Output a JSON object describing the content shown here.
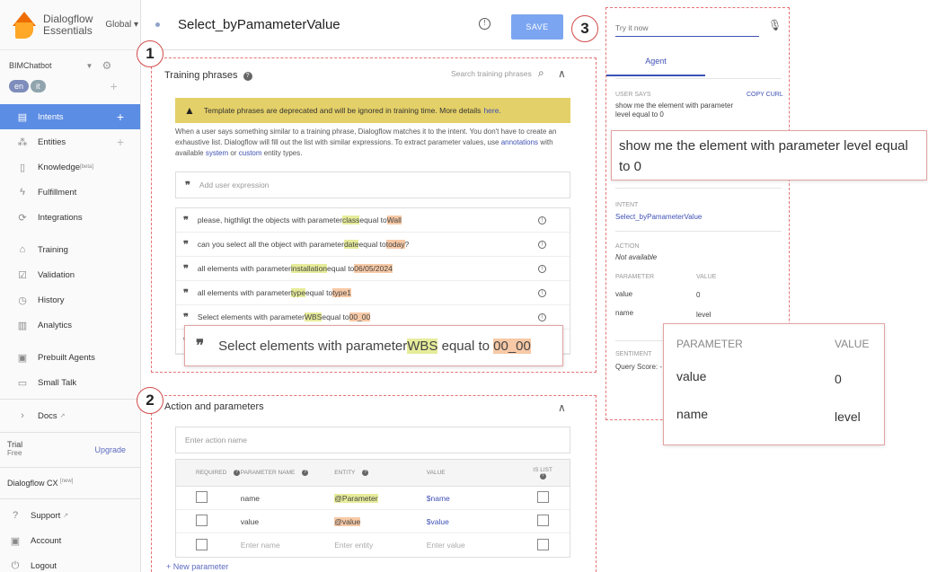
{
  "brand": {
    "name_line1": "Dialogflow",
    "name_line2": "Essentials",
    "region": "Global"
  },
  "agent": {
    "name": "BIMChatbot",
    "langs": [
      "en",
      "it"
    ]
  },
  "nav": {
    "intents": "Intents",
    "entities": "Entities",
    "knowledge": "Knowledge",
    "knowledge_tag": "[beta]",
    "fulfillment": "Fulfillment",
    "integrations": "Integrations",
    "training": "Training",
    "validation": "Validation",
    "history": "History",
    "analytics": "Analytics",
    "prebuilt": "Prebuilt Agents",
    "smalltalk": "Small Talk",
    "docs": "Docs",
    "support": "Support",
    "account": "Account",
    "logout": "Logout"
  },
  "trial": {
    "label": "Trial",
    "plan": "Free",
    "upgrade": "Upgrade"
  },
  "cx": {
    "label": "Dialogflow CX",
    "tag": "[new]"
  },
  "intent": {
    "title": "Select_byPamameterValue",
    "save": "SAVE"
  },
  "badges": [
    "1",
    "2",
    "3"
  ],
  "training": {
    "title": "Training phrases",
    "help": "?",
    "search_placeholder": "Search training phrases",
    "warning": "Template phrases are deprecated and will be ignored in training time. More details",
    "warning_link": "here.",
    "desc_1": "When a user says something similar to a training phrase, Dialogflow matches it to the intent. You don't have to create an exhaustive list. Dialogflow will fill out the list with similar expressions. To extract parameter values, use",
    "desc_annotations": "annotations",
    "desc_2": "with available",
    "desc_system": "system",
    "desc_or": "or",
    "desc_custom": "custom",
    "desc_3": "entity types.",
    "add_placeholder": "Add user expression",
    "phrases": [
      {
        "a": "please, higthligt the objects with parameter ",
        "p": "class",
        "b": " equal to ",
        "v": "Wall",
        "c": ""
      },
      {
        "a": "can you select all the object with parameter ",
        "p": "date",
        "b": " equal to ",
        "v": "today",
        "c": "?"
      },
      {
        "a": "all elements with parameter ",
        "p": "installation",
        "b": " equal to ",
        "v": "06/05/2024",
        "c": ""
      },
      {
        "a": "all elements with parameter ",
        "p": "type",
        "b": " equal to ",
        "v": "type1",
        "c": ""
      },
      {
        "a": "Select elements with parameter ",
        "p": "WBS",
        "b": " equal to ",
        "v": "00_00",
        "c": ""
      }
    ],
    "zoom": {
      "a": "Select elements with parameter ",
      "p": "WBS",
      "b": " equal to ",
      "v": "00_00"
    }
  },
  "action": {
    "title": "Action and parameters",
    "placeholder": "Enter action name",
    "headers": {
      "required": "REQUIRED",
      "name": "PARAMETER NAME",
      "entity": "ENTITY",
      "value": "VALUE",
      "islist": "IS LIST"
    },
    "rows": [
      {
        "name": "name",
        "entity": "@Parameter",
        "value": "$name"
      },
      {
        "name": "value",
        "entity": "@value",
        "value": "$value"
      }
    ],
    "empty": {
      "name": "Enter name",
      "entity": "Enter entity",
      "value": "Enter value"
    },
    "new_param": "+ New parameter"
  },
  "try": {
    "placeholder": "Try it now",
    "tab": "Agent",
    "user_says_label": "USER SAYS",
    "copy_curl": "COPY CURL",
    "user_says": "show me the element with parameter level equal to 0",
    "intent_label": "INTENT",
    "intent": "Select_byPamameterValue",
    "action_label": "ACTION",
    "action": "Not available",
    "param_label": "PARAMETER",
    "value_label": "VALUE",
    "params": [
      {
        "p": "value",
        "v": "0"
      },
      {
        "p": "name",
        "v": "level"
      }
    ],
    "sentiment_label": "SENTIMENT",
    "query_score": "Query Score: -"
  },
  "zoom_text": "show me the element with parameter level equal to 0",
  "colors": {
    "accent": "#5c8de4",
    "dashed": "#e57373",
    "warning": "#e4d068",
    "param_hl": "#e6ec9a",
    "value_hl": "#f7c9a6"
  }
}
